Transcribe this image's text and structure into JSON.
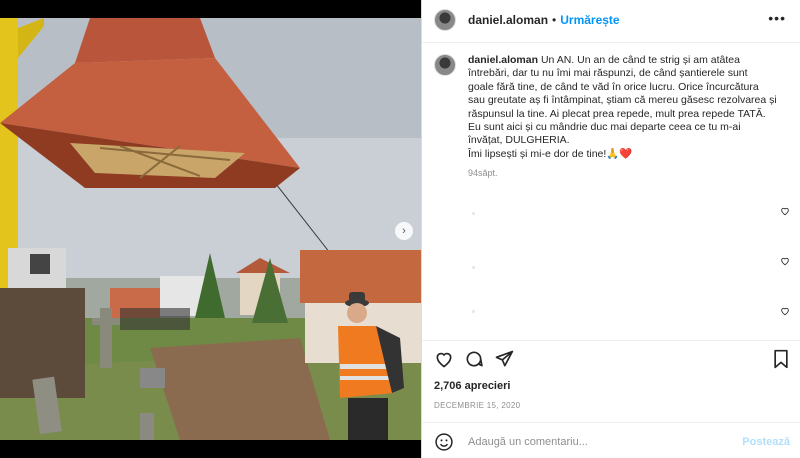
{
  "post": {
    "username": "daniel.aloman",
    "follow_label": "Urmărește",
    "separator": "•",
    "more_label": "•••",
    "caption_lines": [
      "Un AN. Un an de când te strig și am atâtea",
      "întrebări, dar tu nu îmi mai răspunzi, de când șantierele sunt",
      "goale fără tine, de când te văd în orice lucru. Orice încurcătura",
      "sau greutate aș fi întâmpinat, știam că mereu găsesc rezolvarea și",
      "răspunsul la tine. Ai plecat prea repede, mult prea repede TATĂ.",
      "Eu sunt aici și cu mândrie duc mai departe ceea ce tu m-ai",
      "învățat, DULGHERIA.",
      "Îmi lipsești și mi-e dor de tine!🙏❤️"
    ],
    "time_ago": "94săpt.",
    "likes": "2,706 aprecieri",
    "date": "DECEMBRIE 15, 2020",
    "comment_placeholder": "Adaugă un comentariu...",
    "post_button": "Postează",
    "next_arrow": "›"
  },
  "icons": {
    "like": "heart-icon",
    "comment": "comment-icon",
    "share": "send-icon",
    "save": "bookmark-icon",
    "emoji": "emoji-icon"
  },
  "colors": {
    "link_blue": "#0095f6",
    "post_disabled": "#b2dffc",
    "secondary_text": "#8e8e8e"
  },
  "carousel": {
    "slides": 2,
    "active": 1
  }
}
